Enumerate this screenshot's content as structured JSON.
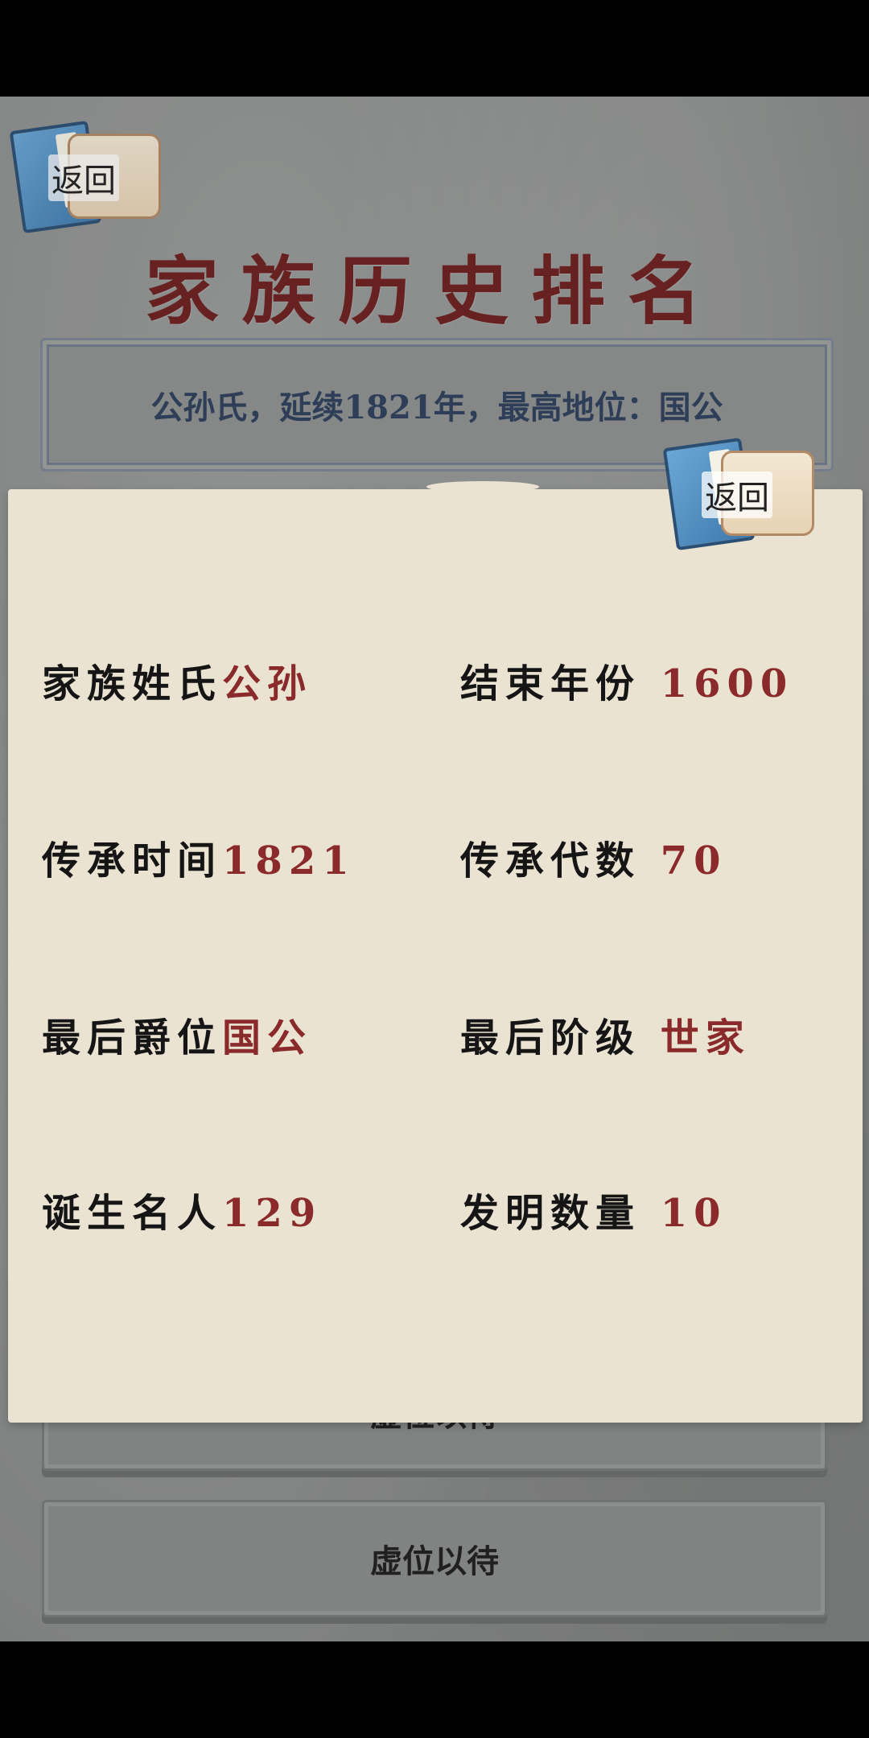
{
  "back_label": "返回",
  "title": "家族历史排名",
  "summary": "公孙氏，延续1821年，最高地位：国公",
  "slots": [
    "虚位以待",
    "虚位以待"
  ],
  "detail": {
    "back_label": "返回",
    "stats": [
      {
        "label": "家族姓氏",
        "value": "公孙"
      },
      {
        "label": "结束年份",
        "value": "1600"
      },
      {
        "label": "传承时间",
        "value": "1821"
      },
      {
        "label": "传承代数",
        "value": "70"
      },
      {
        "label": "最后爵位",
        "value": "国公"
      },
      {
        "label": "最后阶级",
        "value": "世家"
      },
      {
        "label": "诞生名人",
        "value": "129"
      },
      {
        "label": "发明数量",
        "value": "10"
      }
    ]
  },
  "colors": {
    "title": "#6e1f1f",
    "summary_text": "#2d3f5c",
    "value_text": "#8a2a2a",
    "card_bg": "#ebe3d2"
  }
}
